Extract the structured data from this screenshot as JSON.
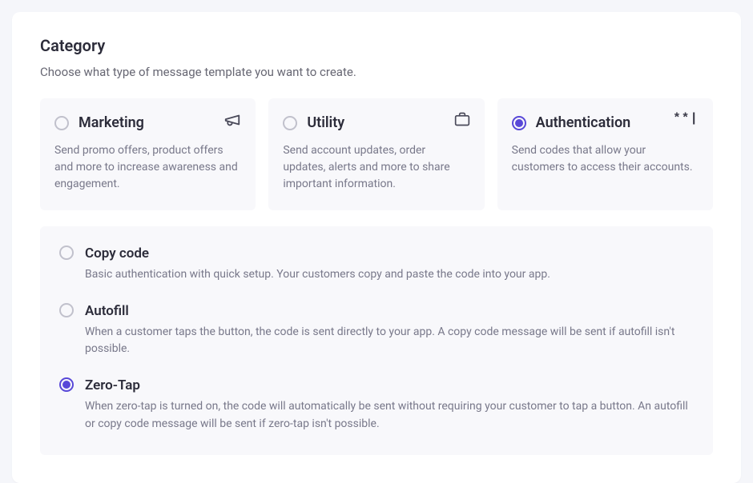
{
  "section": {
    "title": "Category",
    "subtitle": "Choose what type of message template you want to create."
  },
  "categories": [
    {
      "id": "marketing",
      "title": "Marketing",
      "desc": "Send promo offers, product offers and more to increase awareness and engagement.",
      "icon": "megaphone-icon",
      "selected": false
    },
    {
      "id": "utility",
      "title": "Utility",
      "desc": "Send account updates, order updates, alerts and more to share important information.",
      "icon": "briefcase-icon",
      "selected": false
    },
    {
      "id": "authentication",
      "title": "Authentication",
      "desc": "Send codes that allow your customers to access their accounts.",
      "icon": "password-icon",
      "selected": true
    }
  ],
  "auth_options": [
    {
      "id": "copy-code",
      "title": "Copy code",
      "desc": "Basic authentication with quick setup. Your customers copy and paste the code into your app.",
      "selected": false
    },
    {
      "id": "autofill",
      "title": "Autofill",
      "desc": "When a customer taps the button, the code is sent directly to your app. A copy code message will be sent if autofill isn't possible.",
      "selected": false
    },
    {
      "id": "zero-tap",
      "title": "Zero-Tap",
      "desc": "When zero-tap is turned on, the code will automatically be sent without requiring your customer to tap a button. An autofill or copy code message will be sent if zero-tap isn't possible.",
      "selected": true
    }
  ]
}
